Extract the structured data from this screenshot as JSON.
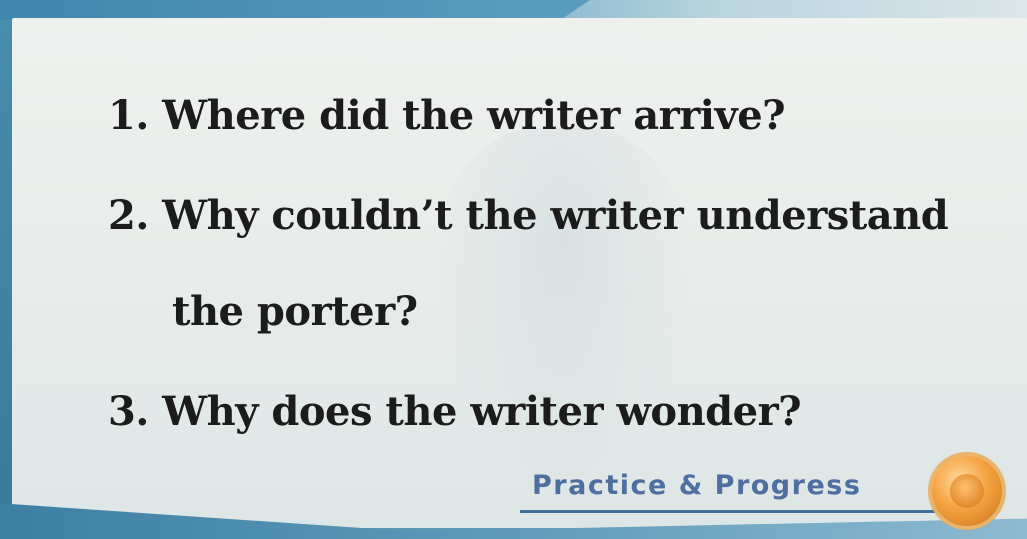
{
  "slide": {
    "questions": [
      "1. Where did the writer arrive?",
      "2. Why couldn’t the writer understand",
      "the porter?",
      "3. Why does the writer wonder?"
    ],
    "footer_label": "Practice & Progress",
    "footer_icon": "orange-orb-icon"
  },
  "colors": {
    "frame_blue": "#5d98b4",
    "panel_bg": "#eef1ee",
    "text": "#1c1c1c",
    "footer_text": "#4e6fa0",
    "orb": "#f5a340"
  }
}
